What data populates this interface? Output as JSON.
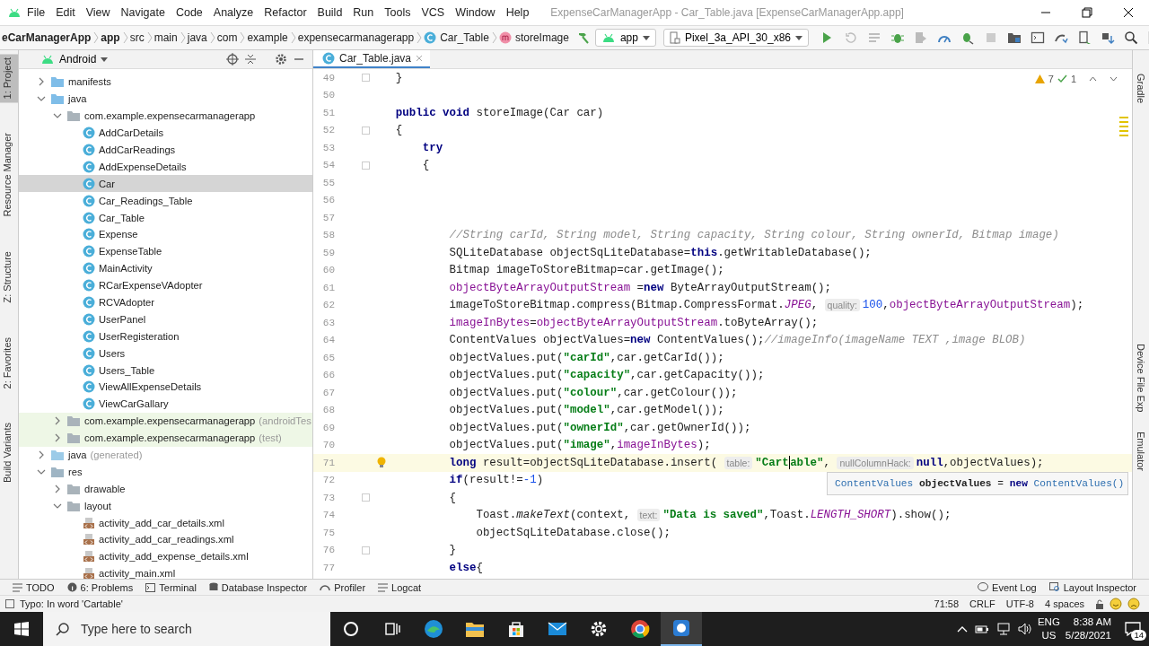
{
  "menu_bar": {
    "items": [
      "File",
      "Edit",
      "View",
      "Navigate",
      "Code",
      "Analyze",
      "Refactor",
      "Build",
      "Run",
      "Tools",
      "VCS",
      "Window",
      "Help"
    ],
    "title": "ExpenseCarManagerApp - Car_Table.java [ExpenseCarManagerApp.app]"
  },
  "nav_bar": {
    "breadcrumbs": [
      {
        "text": "eCarManagerApp",
        "kind": "module"
      },
      {
        "text": "app",
        "kind": "module"
      },
      {
        "text": "src",
        "kind": "dir"
      },
      {
        "text": "main",
        "kind": "dir"
      },
      {
        "text": "java",
        "kind": "dir"
      },
      {
        "text": "com",
        "kind": "dir"
      },
      {
        "text": "example",
        "kind": "dir"
      },
      {
        "text": "expensecarmanagerapp",
        "kind": "dir"
      },
      {
        "text": "Car_Table",
        "kind": "class"
      },
      {
        "text": "storeImage",
        "kind": "method"
      }
    ],
    "run_config": "app",
    "device": "Pixel_3a_API_30_x86"
  },
  "left_strip": [
    {
      "label": "1: Project",
      "selected": true
    },
    {
      "label": "Resource Manager",
      "selected": false
    },
    {
      "label": "Z: Structure",
      "selected": false
    },
    {
      "label": "2: Favorites",
      "selected": false
    },
    {
      "label": "Build Variants",
      "selected": false
    }
  ],
  "project_panel": {
    "view": "Android",
    "tree": [
      {
        "label": "manifests",
        "kind": "folder",
        "expanded": false,
        "selected": false
      },
      {
        "label": "java",
        "kind": "folder",
        "expanded": true,
        "selected": false,
        "children": [
          {
            "label": "com.example.expensecarmanagerapp",
            "kind": "package",
            "expanded": true,
            "selected": false,
            "children": [
              {
                "label": "AddCarDetails",
                "kind": "class",
                "selected": false
              },
              {
                "label": "AddCarReadings",
                "kind": "class",
                "selected": false
              },
              {
                "label": "AddExpenseDetails",
                "kind": "class",
                "selected": false
              },
              {
                "label": "Car",
                "kind": "class",
                "selected": true
              },
              {
                "label": "Car_Readings_Table",
                "kind": "class",
                "selected": false
              },
              {
                "label": "Car_Table",
                "kind": "class",
                "selected": false
              },
              {
                "label": "Expense",
                "kind": "class",
                "selected": false
              },
              {
                "label": "ExpenseTable",
                "kind": "class",
                "selected": false
              },
              {
                "label": "MainActivity",
                "kind": "class",
                "selected": false
              },
              {
                "label": "RCarExpenseVAdopter",
                "kind": "class",
                "selected": false
              },
              {
                "label": "RCVAdopter",
                "kind": "class",
                "selected": false
              },
              {
                "label": "UserPanel",
                "kind": "class",
                "selected": false
              },
              {
                "label": "UserRegisteration",
                "kind": "class",
                "selected": false
              },
              {
                "label": "Users",
                "kind": "class",
                "selected": false
              },
              {
                "label": "Users_Table",
                "kind": "class",
                "selected": false
              },
              {
                "label": "ViewAllExpenseDetails",
                "kind": "class",
                "selected": false
              },
              {
                "label": "ViewCarGallary",
                "kind": "class",
                "selected": false
              }
            ]
          },
          {
            "label": "com.example.expensecarmanagerapp",
            "suffix": "(androidTes",
            "kind": "test-package",
            "expanded": false,
            "selected": false
          },
          {
            "label": "com.example.expensecarmanagerapp",
            "suffix": "(test)",
            "kind": "test-package",
            "expanded": false,
            "selected": false
          }
        ]
      },
      {
        "label": "java",
        "suffix": "(generated)",
        "kind": "generated-folder",
        "expanded": false,
        "selected": false
      },
      {
        "label": "res",
        "kind": "res-folder",
        "expanded": true,
        "selected": false,
        "children": [
          {
            "label": "drawable",
            "kind": "package",
            "expanded": false,
            "selected": false
          },
          {
            "label": "layout",
            "kind": "package",
            "expanded": true,
            "selected": false,
            "children": [
              {
                "label": "activity_add_car_details.xml",
                "kind": "xml",
                "selected": false
              },
              {
                "label": "activity_add_car_readings.xml",
                "kind": "xml",
                "selected": false
              },
              {
                "label": "activity_add_expense_details.xml",
                "kind": "xml",
                "selected": false
              },
              {
                "label": "activity_main.xml",
                "kind": "xml",
                "selected": false
              }
            ]
          }
        ]
      }
    ]
  },
  "editor": {
    "tabs": [
      {
        "label": "Car_Table.java",
        "selected": true
      }
    ],
    "warnings": "7",
    "checks": "1",
    "lines": [
      {
        "number": "49",
        "fold": true,
        "current": false,
        "tokens": [
          {
            "kind": "p",
            "text": "    }"
          }
        ]
      },
      {
        "number": "50",
        "current": false
      },
      {
        "number": "51",
        "current": false,
        "tokens": [
          {
            "kind": "k",
            "text": "    public void"
          },
          {
            "kind": "p",
            "text": " storeImage(Car car)"
          }
        ]
      },
      {
        "number": "52",
        "fold": true,
        "current": false,
        "tokens": [
          {
            "kind": "p",
            "text": "    {"
          }
        ]
      },
      {
        "number": "53",
        "current": false,
        "tokens": [
          {
            "kind": "k",
            "text": "        try"
          }
        ]
      },
      {
        "number": "54",
        "fold": true,
        "current": false,
        "tokens": [
          {
            "kind": "p",
            "text": "        {"
          }
        ]
      },
      {
        "number": "55",
        "current": false
      },
      {
        "number": "56",
        "current": false
      },
      {
        "number": "57",
        "current": false
      },
      {
        "number": "58",
        "current": false,
        "tokens": [
          {
            "kind": "c",
            "text": "            //String carId, String model, String capacity, String colour, String ownerId, Bitmap image)"
          }
        ]
      },
      {
        "number": "59",
        "current": false,
        "tokens": [
          {
            "kind": "p",
            "text": "            SQLiteDatabase objectSqLiteDatabase="
          },
          {
            "kind": "k",
            "text": "this"
          },
          {
            "kind": "p",
            "text": ".getWritableDatabase();"
          }
        ]
      },
      {
        "number": "60",
        "current": false,
        "tokens": [
          {
            "kind": "p",
            "text": "            Bitmap imageToStoreBitmap=car.getImage();"
          }
        ]
      },
      {
        "number": "61",
        "current": false,
        "tokens": [
          {
            "kind": "f",
            "text": "            objectByteArrayOutputStream"
          },
          {
            "kind": "p",
            "text": " ="
          },
          {
            "kind": "k",
            "text": "new"
          },
          {
            "kind": "p",
            "text": " ByteArrayOutputStream();"
          }
        ]
      },
      {
        "number": "62",
        "current": false,
        "tokens": [
          {
            "kind": "p",
            "text": "            imageToStoreBitmap.compress(Bitmap.CompressFormat."
          },
          {
            "kind": "i",
            "text": "JPEG"
          },
          {
            "kind": "p",
            "text": ", "
          },
          {
            "kind": "h",
            "text": "quality:"
          },
          {
            "kind": "n",
            "text": "100"
          },
          {
            "kind": "p",
            "text": ","
          },
          {
            "kind": "f",
            "text": "objectByteArrayOutputStream"
          },
          {
            "kind": "p",
            "text": ");"
          }
        ]
      },
      {
        "number": "63",
        "current": false,
        "tokens": [
          {
            "kind": "f",
            "text": "            imageInBytes"
          },
          {
            "kind": "p",
            "text": "="
          },
          {
            "kind": "f",
            "text": "objectByteArrayOutputStream"
          },
          {
            "kind": "p",
            "text": ".toByteArray();"
          }
        ]
      },
      {
        "number": "64",
        "current": false,
        "tokens": [
          {
            "kind": "p",
            "text": "            ContentValues objectValues="
          },
          {
            "kind": "k",
            "text": "new"
          },
          {
            "kind": "p",
            "text": " ContentValues();"
          },
          {
            "kind": "c",
            "text": "//imageInfo(imageName TEXT ,image BLOB)"
          }
        ]
      },
      {
        "number": "65",
        "current": false,
        "tokens": [
          {
            "kind": "p",
            "text": "            objectValues.put("
          },
          {
            "kind": "s",
            "text": "\"carId\""
          },
          {
            "kind": "p",
            "text": ",car.getCarId());"
          }
        ]
      },
      {
        "number": "66",
        "current": false,
        "tokens": [
          {
            "kind": "p",
            "text": "            objectValues.put("
          },
          {
            "kind": "s",
            "text": "\"capacity\""
          },
          {
            "kind": "p",
            "text": ",car.getCapacity());"
          }
        ]
      },
      {
        "number": "67",
        "current": false,
        "tokens": [
          {
            "kind": "p",
            "text": "            objectValues.put("
          },
          {
            "kind": "s",
            "text": "\"colour\""
          },
          {
            "kind": "p",
            "text": ",car.getColour());"
          }
        ]
      },
      {
        "number": "68",
        "current": false,
        "tokens": [
          {
            "kind": "p",
            "text": "            objectValues.put("
          },
          {
            "kind": "s",
            "text": "\"model\""
          },
          {
            "kind": "p",
            "text": ",car.getModel());"
          }
        ]
      },
      {
        "number": "69",
        "current": false,
        "tokens": [
          {
            "kind": "p",
            "text": "            objectValues.put("
          },
          {
            "kind": "s",
            "text": "\"ownerId\""
          },
          {
            "kind": "p",
            "text": ",car.getOwnerId());"
          }
        ]
      },
      {
        "number": "70",
        "current": false,
        "tokens": [
          {
            "kind": "p",
            "text": "            objectValues.put("
          },
          {
            "kind": "s",
            "text": "\"image\""
          },
          {
            "kind": "p",
            "text": ","
          },
          {
            "kind": "f",
            "text": "imageInBytes"
          },
          {
            "kind": "p",
            "text": ");"
          }
        ]
      },
      {
        "number": "71",
        "current": true,
        "bulb": true,
        "tokens": [
          {
            "kind": "k",
            "text": "            long"
          },
          {
            "kind": "p",
            "text": " result=objectSqLiteDatabase.insert( "
          },
          {
            "kind": "h",
            "text": "table:"
          },
          {
            "kind": "s",
            "text": "\"Cart"
          },
          {
            "kind": "caret"
          },
          {
            "kind": "s",
            "text": "able\""
          },
          {
            "kind": "p",
            "text": ", "
          },
          {
            "kind": "h",
            "text": "nullColumnHack:"
          },
          {
            "kind": "k",
            "text": "null"
          },
          {
            "kind": "p",
            "text": ",objectValues);"
          }
        ]
      },
      {
        "number": "72",
        "current": false,
        "tokens": [
          {
            "kind": "k",
            "text": "            if"
          },
          {
            "kind": "p",
            "text": "(result!="
          },
          {
            "kind": "n",
            "text": "-1"
          },
          {
            "kind": "p",
            "text": ")"
          }
        ]
      },
      {
        "number": "73",
        "fold": true,
        "current": false,
        "tokens": [
          {
            "kind": "p",
            "text": "            {"
          }
        ]
      },
      {
        "number": "74",
        "current": false,
        "tokens": [
          {
            "kind": "p",
            "text": "                Toast."
          },
          {
            "kind": "m",
            "text": "makeText"
          },
          {
            "kind": "p",
            "text": "(context, "
          },
          {
            "kind": "h",
            "text": "text:"
          },
          {
            "kind": "s",
            "text": "\"Data is saved\""
          },
          {
            "kind": "p",
            "text": ",Toast."
          },
          {
            "kind": "i",
            "text": "LENGTH_SHORT"
          },
          {
            "kind": "p",
            "text": ").show();"
          }
        ]
      },
      {
        "number": "75",
        "current": false,
        "tokens": [
          {
            "kind": "p",
            "text": "                objectSqLiteDatabase.close();"
          }
        ]
      },
      {
        "number": "76",
        "fold": true,
        "current": false,
        "tokens": [
          {
            "kind": "p",
            "text": "            }"
          }
        ]
      },
      {
        "number": "77",
        "current": false,
        "tokens": [
          {
            "kind": "k",
            "text": "            else"
          },
          {
            "kind": "p",
            "text": "{"
          }
        ]
      }
    ],
    "popup": [
      {
        "kind": "t",
        "text": "ContentValues"
      },
      {
        "kind": "b",
        "text": " objectValues"
      },
      {
        "kind": "p",
        "text": " = "
      },
      {
        "kind": "k",
        "text": "new"
      },
      {
        "kind": "t",
        "text": " ContentValues()"
      }
    ]
  },
  "right_strip": [
    "Gradle",
    "Device File Exp",
    "Emulator"
  ],
  "tool_windows": {
    "left": [
      {
        "label": "TODO",
        "kind": "list"
      },
      {
        "label": "6: Problems",
        "kind": "info"
      },
      {
        "label": "Terminal",
        "kind": "terminal"
      },
      {
        "label": "Database Inspector",
        "kind": "database"
      },
      {
        "label": "Profiler",
        "kind": "gauge"
      },
      {
        "label": "Logcat",
        "kind": "list"
      }
    ],
    "right": [
      {
        "label": "Event Log",
        "kind": "bubble"
      },
      {
        "label": "Layout Inspector",
        "kind": "inspect"
      }
    ]
  },
  "status_bar": {
    "message": "Typo: In word 'Cartable'",
    "items": [
      "71:58",
      "CRLF",
      "UTF-8",
      "4 spaces"
    ]
  },
  "taskbar": {
    "search_placeholder": "Type here to search",
    "language": [
      "ENG",
      "US"
    ],
    "time": "8:38 AM",
    "date": "5/28/2021",
    "notifications": "14"
  }
}
